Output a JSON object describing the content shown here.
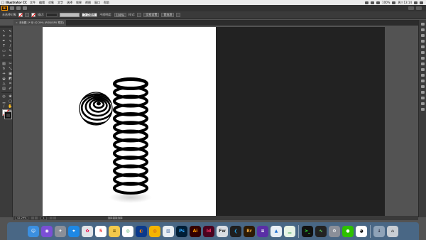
{
  "menubar": {
    "app_name": "Illustrator CC",
    "menus": [
      "文件",
      "编辑",
      "对象",
      "文字",
      "选择",
      "效果",
      "视图",
      "窗口",
      "帮助"
    ],
    "battery": "100%",
    "clock": "周三13:14"
  },
  "controlbar": {
    "no_selection": "未选择对象",
    "stroke_label": "描边:",
    "style_dropdown": "5 点圆形",
    "opacity_label": "不透明度:",
    "opacity_value": "100%",
    "style_label": "样式:",
    "doc_setup_button": "文档设置",
    "preferences_button": "首选项"
  },
  "document_tab": {
    "title": "未标题-1* @ 42.29% (RGB/GPU 预览)"
  },
  "statusbar": {
    "zoom": "42.29%",
    "page": "1",
    "tool": "选择直接选择"
  },
  "toolbox": {
    "tools": [
      "select-arrow",
      "direct-select-arrow",
      "magic-wand",
      "lasso",
      "pen",
      "curvature",
      "type",
      "line",
      "rectangle",
      "paintbrush",
      "shaper",
      "pencil",
      "eraser",
      "scissors",
      "rotate",
      "scale",
      "width",
      "free-transform",
      "shape-builder",
      "live-paint",
      "perspective",
      "mesh",
      "gradient",
      "eyedropper",
      "blend",
      "symbol-sprayer",
      "column-graph",
      "artboard",
      "slice",
      "hand",
      "zoom",
      "print-tiling"
    ]
  },
  "artwork": {
    "colors": {
      "stripe": "#000000",
      "background": "#ffffff",
      "dark_artboard": "#222222",
      "canvas": "#535353"
    },
    "column_rings": 13,
    "sphere_bands": 5
  },
  "dock": {
    "apps": [
      "finder",
      "siri",
      "launchpad",
      "safari",
      "photos",
      "calendar",
      "notes",
      "chrome",
      "firefox",
      "chrome-canary",
      "preview",
      "photoshop",
      "illustrator",
      "indesign",
      "fireworks",
      "vscode",
      "bridge",
      "ruler-app",
      "keynote",
      "numbers",
      "terminal",
      "activity-monitor",
      "system-preferences",
      "wechat",
      "qq",
      "downloads",
      "trash"
    ]
  }
}
